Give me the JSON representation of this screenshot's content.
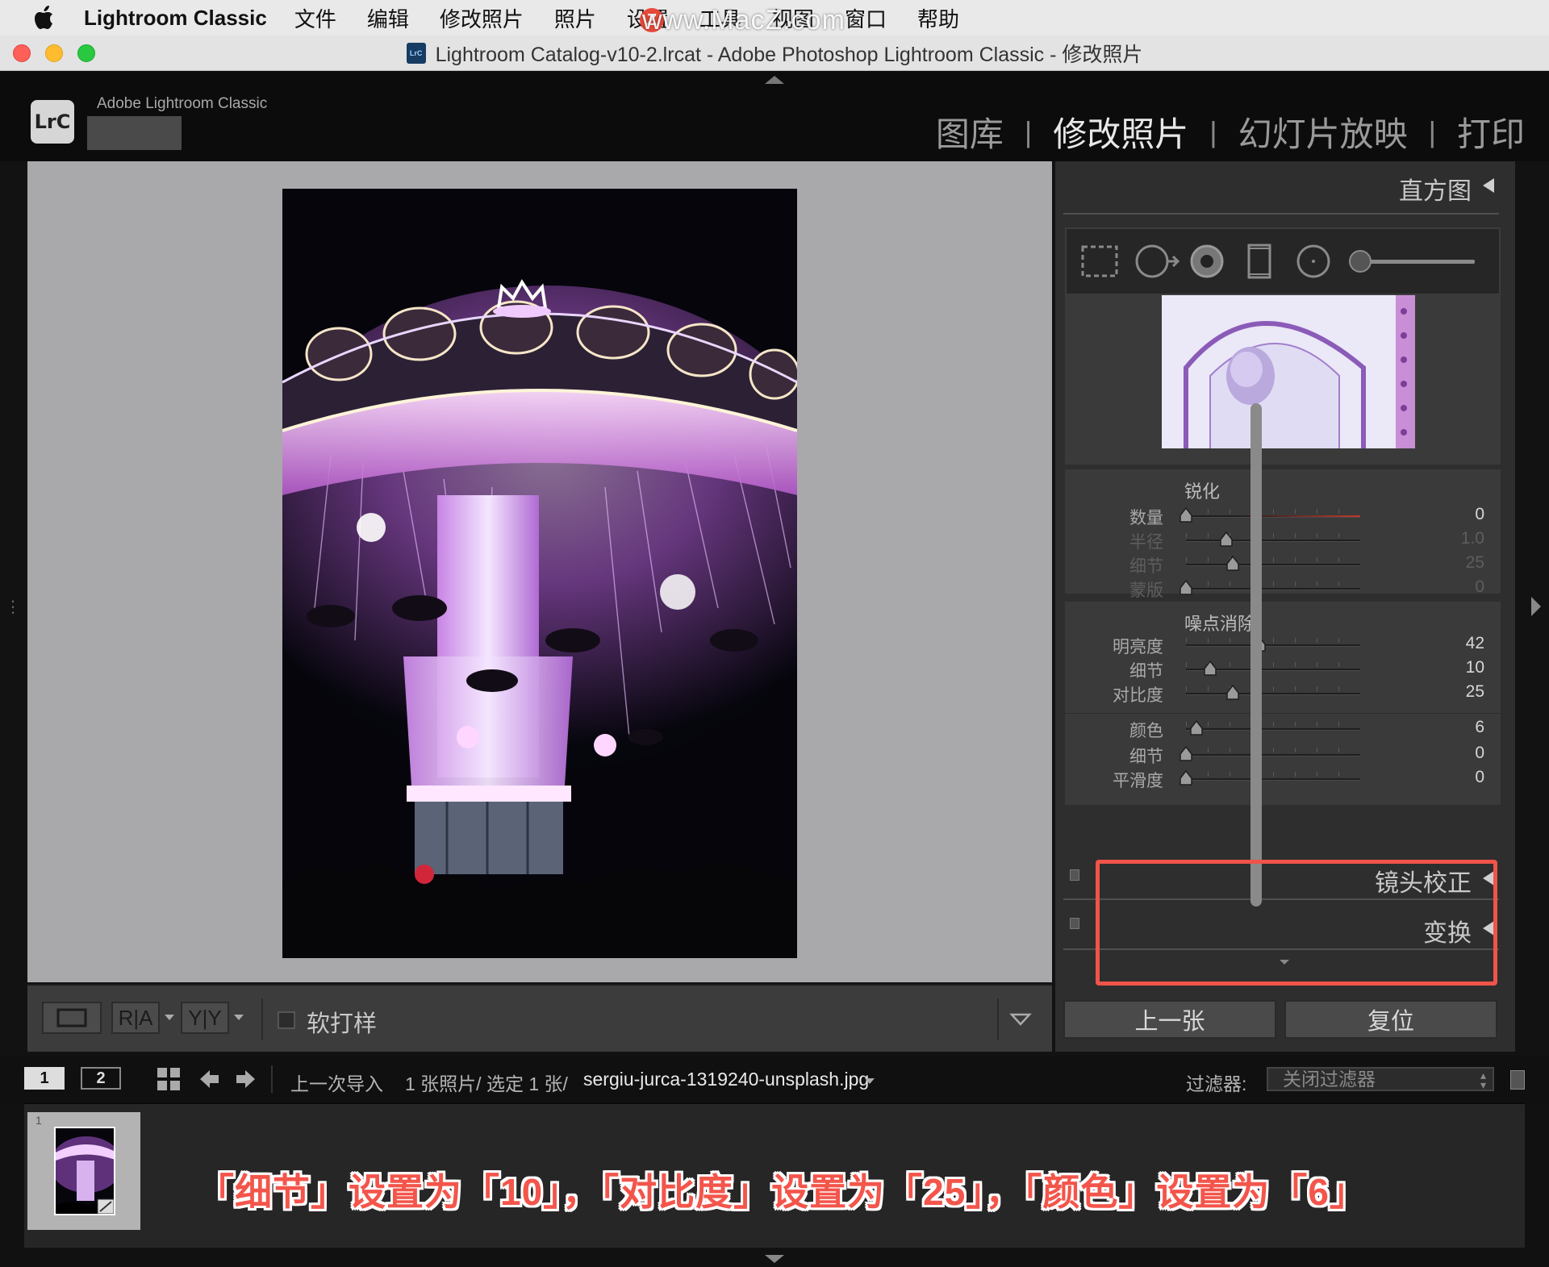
{
  "menubar": {
    "app_name": "Lightroom Classic",
    "items": [
      "文件",
      "编辑",
      "修改照片",
      "照片",
      "设置",
      "工具",
      "视图",
      "窗口",
      "帮助"
    ],
    "watermark": "www.MacZ.com"
  },
  "window": {
    "title": "Lightroom Catalog-v10-2.lrcat - Adobe Photoshop Lightroom Classic - 修改照片"
  },
  "header": {
    "logo": "LrC",
    "brand": "Adobe Lightroom Classic",
    "modules": [
      "图库",
      "修改照片",
      "幻灯片放映",
      "打印"
    ],
    "active_module": "修改照片"
  },
  "toolbar": {
    "view_ra": "R|A",
    "view_yy": "Y|Y",
    "softproof_label": "软打样",
    "softproof_checked": false
  },
  "right_panel": {
    "histogram_title": "直方图",
    "sharpening": {
      "title": "锐化",
      "sliders": [
        {
          "label": "数量",
          "value": "0",
          "position": 0.0,
          "dim": false
        },
        {
          "label": "半径",
          "value": "1.0",
          "position": 0.23,
          "dim": true
        },
        {
          "label": "细节",
          "value": "25",
          "position": 0.27,
          "dim": true
        },
        {
          "label": "蒙版",
          "value": "0",
          "position": 0.0,
          "dim": true
        }
      ]
    },
    "noise_reduction": {
      "title": "噪点消除",
      "sliders": [
        {
          "label": "明亮度",
          "value": "42",
          "position": 0.42,
          "dim": false
        },
        {
          "label": "细节",
          "value": "10",
          "position": 0.14,
          "dim": false
        },
        {
          "label": "对比度",
          "value": "25",
          "position": 0.27,
          "dim": false
        },
        {
          "label": "颜色",
          "value": "6",
          "position": 0.06,
          "dim": false
        },
        {
          "label": "细节",
          "value": "0",
          "position": 0.0,
          "dim": false
        },
        {
          "label": "平滑度",
          "value": "0",
          "position": 0.0,
          "dim": false
        }
      ]
    },
    "lens_correction_title": "镜头校正",
    "transform_title": "变换",
    "prev_button": "上一张",
    "reset_button": "复位"
  },
  "filmbar": {
    "screen1": "1",
    "screen2": "2",
    "source": "上一次导入",
    "count": "1 张照片/ 选定 1 张/",
    "filename": "sergiu-jurca-1319240-unsplash.jpg",
    "filter_label": "过滤器:",
    "filter_value": "关闭过滤器"
  },
  "filmstrip": {
    "index": "1",
    "caption": "「细节」设置为「10」，「对比度」设置为「25」，「颜色」设置为「6」"
  },
  "colors": {
    "accent_highlight": "#f0544a",
    "caption_red": "#f3554b",
    "track_red": "#c0392b"
  }
}
